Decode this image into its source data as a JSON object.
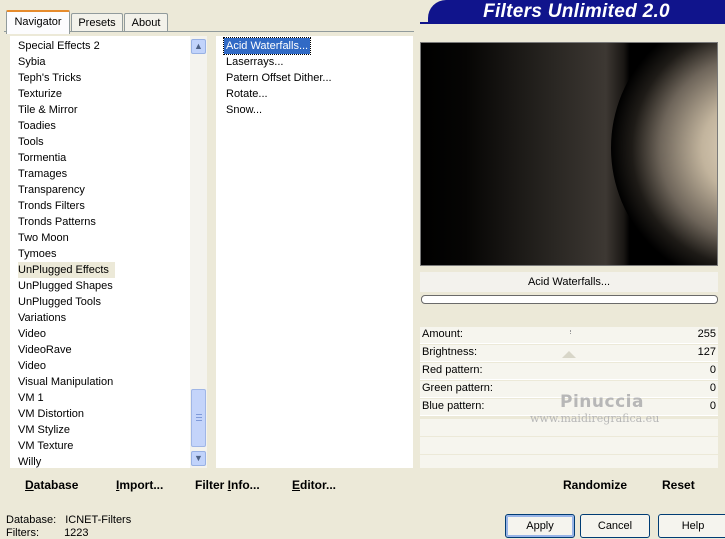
{
  "tabs": [
    {
      "label": "Navigator",
      "active": true
    },
    {
      "label": "Presets",
      "active": false
    },
    {
      "label": "About",
      "active": false
    }
  ],
  "title": "Filters Unlimited 2.0",
  "categories": [
    "Special Effects 2",
    "Sybia",
    "Teph's Tricks",
    "Texturize",
    "Tile & Mirror",
    "Toadies",
    "Tools",
    "Tormentia",
    "Tramages",
    "Transparency",
    "Tronds Filters",
    "Tronds Patterns",
    "Two Moon",
    "Tymoes",
    "UnPlugged Effects",
    "UnPlugged Shapes",
    "UnPlugged Tools",
    "Variations",
    "Video",
    "VideoRave",
    "Video",
    "Visual Manipulation",
    "VM 1",
    "VM Distortion",
    "VM Stylize",
    "VM Texture",
    "Willy"
  ],
  "selected_category": "UnPlugged Effects",
  "filters": [
    "Acid Waterfalls...",
    "Laserrays...",
    "Patern Offset Dither...",
    "Rotate...",
    "Snow..."
  ],
  "selected_filter": "Acid Waterfalls...",
  "preview_filter_name": "Acid Waterfalls...",
  "progress": 0,
  "params": [
    {
      "label": "Amount:",
      "value": "255"
    },
    {
      "label": "Brightness:",
      "value": "127"
    },
    {
      "label": "Red pattern:",
      "value": "0"
    },
    {
      "label": "Green pattern:",
      "value": "0"
    },
    {
      "label": "Blue pattern:",
      "value": "0"
    }
  ],
  "watermark": {
    "line1": "Pinuccia",
    "line2": "www.maidiregrafica.eu"
  },
  "left_buttons": [
    {
      "label": "Database",
      "ul": "D"
    },
    {
      "label": "Import...",
      "ul": "I"
    },
    {
      "label": "Filter Info...",
      "ul": "I"
    },
    {
      "label": "Editor...",
      "ul": "E"
    }
  ],
  "right_buttons": {
    "randomize": "Randomize",
    "reset": "Reset"
  },
  "status": {
    "database_label": "Database:",
    "database_value": "ICNET-Filters",
    "filters_label": "Filters:",
    "filters_value": "1223"
  },
  "dialog_buttons": {
    "apply": "Apply",
    "cancel": "Cancel",
    "help": "Help"
  },
  "colors": {
    "banner": "#10148c",
    "selection": "#316ac5",
    "panel": "#ece9d8"
  }
}
